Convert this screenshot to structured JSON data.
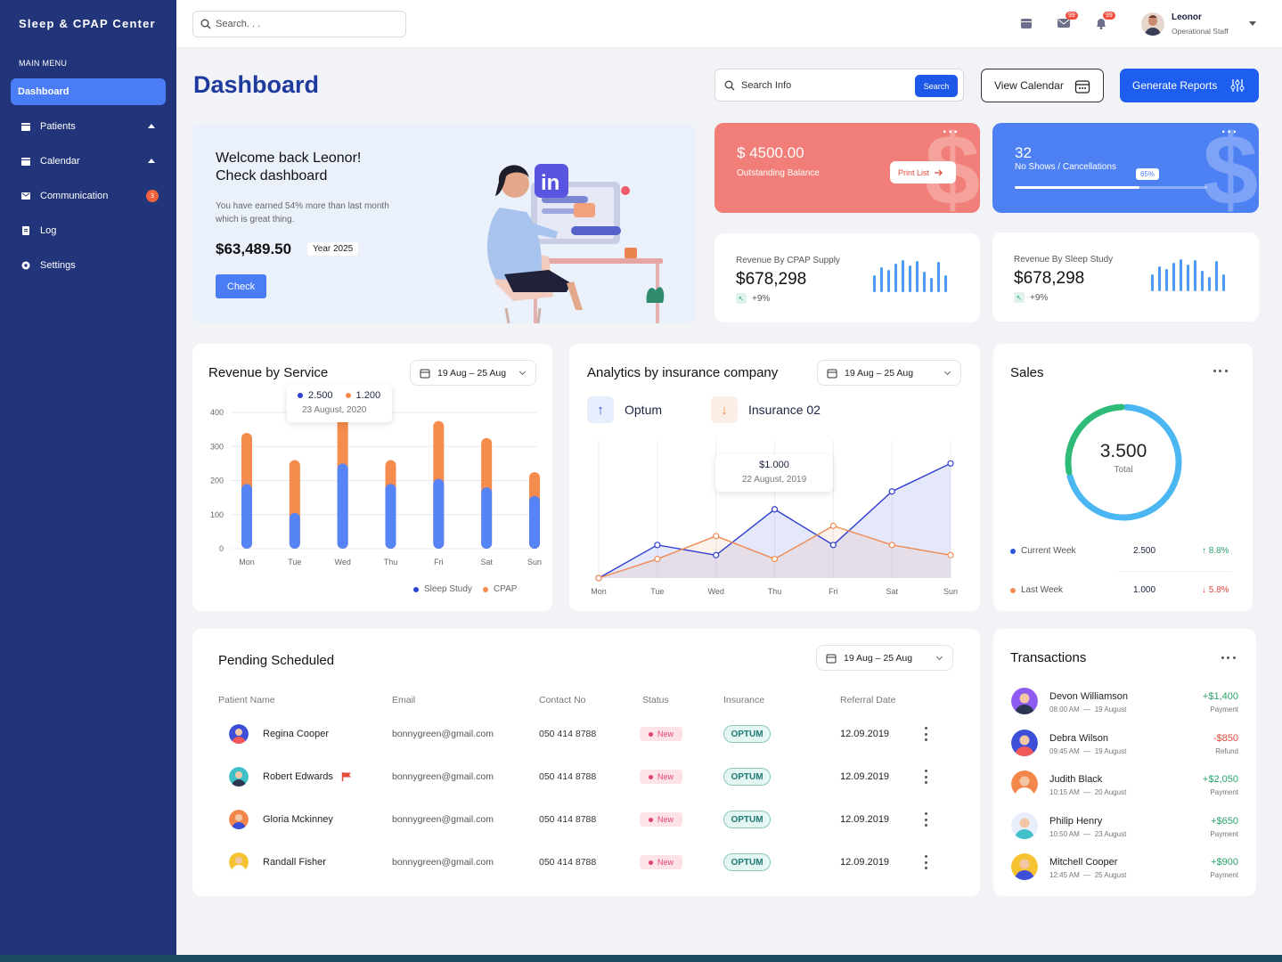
{
  "sidebar": {
    "brand": "Sleep & CPAP Center",
    "menu_title": "MAIN MENU",
    "items": [
      {
        "label": "Dashboard"
      },
      {
        "label": "Patients"
      },
      {
        "label": "Calendar"
      },
      {
        "label": "Communication",
        "badge": "3"
      },
      {
        "label": "Log"
      },
      {
        "label": "Settings"
      }
    ]
  },
  "topbar": {
    "search_placeholder": "Search. . .",
    "mail_badge": "99",
    "bell_badge": "99",
    "user_name": "Leonor",
    "user_role": "Operational Staff"
  },
  "header": {
    "title": "Dashboard",
    "search_placeholder": "Search Info",
    "search_button": "Search",
    "view_calendar": "View Calendar",
    "generate_reports": "Generate Reports"
  },
  "welcome": {
    "line1": "Welcome back Leonor!",
    "line2": "Check dashboard",
    "subtext": "You have earned 54% more than last month which is great thing.",
    "amount": "$63,489.50",
    "year": "Year 2025",
    "button": "Check"
  },
  "outstanding": {
    "value": "$ 4500.00",
    "label": "Outstanding Balance",
    "button": "Print List"
  },
  "noshows": {
    "value": "32",
    "label": "No Shows / Cancellations",
    "progress_label": "65%",
    "progress": 0.65
  },
  "revenue_cpap": {
    "label": "Revenue By CPAP Supply",
    "value": "$678,298",
    "change": "+9%"
  },
  "revenue_sleep": {
    "label": "Revenue By Sleep Study",
    "value": "$678,298",
    "change": "+9%"
  },
  "revenue_service": {
    "title": "Revenue by Service",
    "date_range": "19 Aug – 25 Aug",
    "tooltip_v1": "2.500",
    "tooltip_v2": "1.200",
    "tooltip_date": "23 August, 2020",
    "legend": [
      "Sleep Study",
      "CPAP"
    ]
  },
  "analytics": {
    "title": "Analytics by insurance company",
    "date_range": "19 Aug – 25 Aug",
    "legend1": "Optum",
    "legend2": "Insurance 02",
    "tooltip_value": "$1.000",
    "tooltip_date": "22 August, 2019"
  },
  "sales": {
    "title": "Sales",
    "total": "3.500",
    "total_label": "Total",
    "rows": [
      {
        "label": "Current Week",
        "value": "2.500",
        "change": "↑ 8.8%"
      },
      {
        "label": "Last Week",
        "value": "1.000",
        "change": "↓ 5.8%"
      }
    ]
  },
  "pending": {
    "title": "Pending Scheduled",
    "date_range": "19 Aug – 25 Aug",
    "columns": [
      "Patient Name",
      "Email",
      "Contact No",
      "Status",
      "Insurance",
      "Referral Date"
    ],
    "rows": [
      {
        "name": "Regina Cooper",
        "email": "bonnygreen@gmail.com",
        "contact": "050 414 8788",
        "status": "New",
        "insurance": "OPTUM",
        "date": "12.09.2019"
      },
      {
        "name": "Robert Edwards",
        "email": "bonnygreen@gmail.com",
        "contact": "050 414 8788",
        "status": "New",
        "insurance": "OPTUM",
        "date": "12.09.2019"
      },
      {
        "name": "Gloria Mckinney",
        "email": "bonnygreen@gmail.com",
        "contact": "050 414 8788",
        "status": "New",
        "insurance": "OPTUM",
        "date": "12.09.2019"
      },
      {
        "name": "Randall Fisher",
        "email": "bonnygreen@gmail.com",
        "contact": "050 414 8788",
        "status": "New",
        "insurance": "OPTUM",
        "date": "12.09.2019"
      }
    ]
  },
  "transactions": {
    "title": "Transactions",
    "rows": [
      {
        "name": "Devon Williamson",
        "time": "08:00 AM",
        "date": "19 August",
        "amount": "+$1,400",
        "type": "Payment"
      },
      {
        "name": "Debra Wilson",
        "time": "09:45 AM",
        "date": "19 August",
        "amount": "-$850",
        "type": "Refund"
      },
      {
        "name": "Judith Black",
        "time": "10:15 AM",
        "date": "20 August",
        "amount": "+$2,050",
        "type": "Payment"
      },
      {
        "name": "Philip Henry",
        "time": "10:50 AM",
        "date": "23 August",
        "amount": "+$650",
        "type": "Payment"
      },
      {
        "name": "Mitchell Cooper",
        "time": "12:45 AM",
        "date": "25 August",
        "amount": "+$900",
        "type": "Payment"
      }
    ]
  },
  "colors": {
    "accent": "#1d5ef0",
    "sidebar": "#23357a",
    "sleep_study": "#5683f6",
    "cpap": "#f58b4c",
    "positive": "#2ba36b",
    "negative": "#e24a3b"
  },
  "chart_data": [
    {
      "type": "bar",
      "title": "Revenue by Service",
      "categories": [
        "Mon",
        "Tue",
        "Wed",
        "Thu",
        "Fri",
        "Sat",
        "Sun"
      ],
      "stacked": true,
      "ylim": [
        0,
        400
      ],
      "yticks": [
        0,
        100,
        200,
        300,
        400
      ],
      "series": [
        {
          "name": "Sleep Study",
          "values": [
            190,
            105,
            250,
            190,
            205,
            180,
            155
          ]
        },
        {
          "name": "CPAP",
          "values": [
            150,
            155,
            160,
            70,
            170,
            145,
            70
          ]
        }
      ],
      "grid": true,
      "legend": "bottom-right"
    },
    {
      "type": "area",
      "title": "Analytics by insurance company",
      "categories": [
        "Mon",
        "Tue",
        "Wed",
        "Thu",
        "Fri",
        "Sat",
        "Sun"
      ],
      "series": [
        {
          "name": "Optum",
          "values": [
            0,
            260,
            180,
            540,
            260,
            680,
            900
          ]
        },
        {
          "name": "Insurance 02",
          "values": [
            0,
            150,
            330,
            150,
            410,
            260,
            180
          ]
        }
      ],
      "ylim": [
        0,
        1000
      ],
      "grid": true
    },
    {
      "type": "pie",
      "title": "Sales",
      "categories": [
        "Current Week",
        "Last Week"
      ],
      "values": [
        2500,
        1000
      ]
    },
    {
      "type": "bar",
      "title": "Revenue By CPAP Supply",
      "values": [
        18,
        26,
        24,
        30,
        34,
        28,
        33,
        22,
        15,
        32,
        18
      ]
    },
    {
      "type": "bar",
      "title": "Revenue By Sleep Study",
      "values": [
        18,
        26,
        24,
        30,
        34,
        28,
        33,
        22,
        15,
        32,
        18
      ]
    }
  ]
}
